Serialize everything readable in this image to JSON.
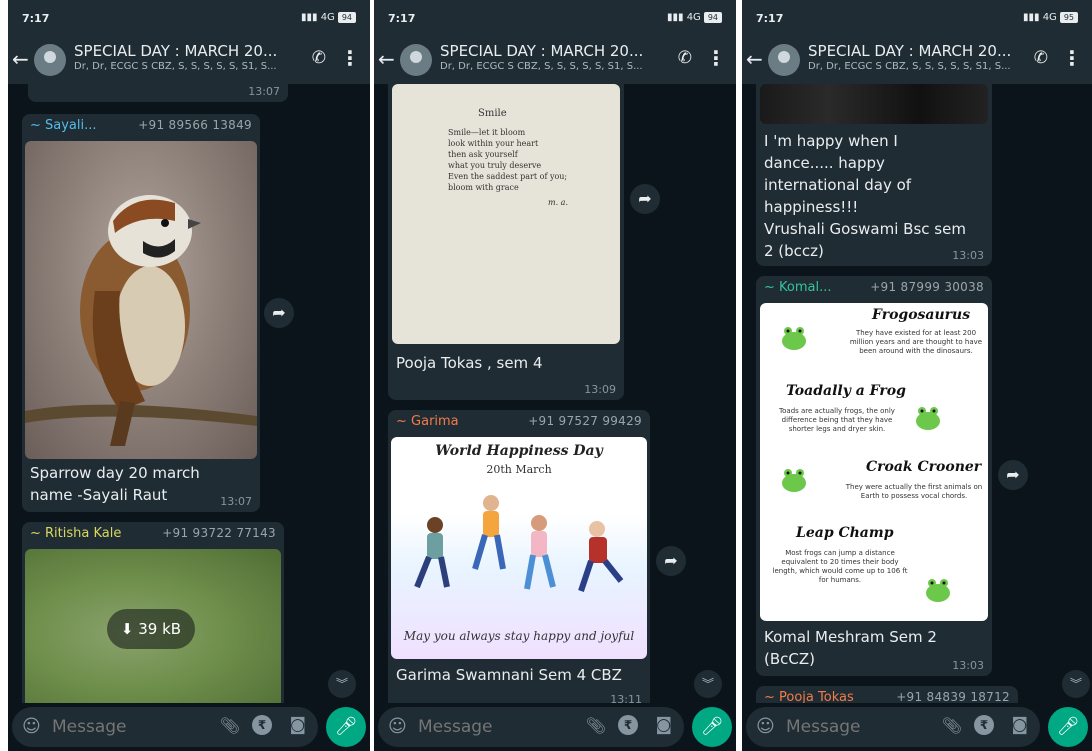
{
  "status": {
    "time": "7:17",
    "network": "4G",
    "battery_left": "94",
    "battery_right": "95"
  },
  "header": {
    "title": "SPECIAL DAY : MARCH 20...",
    "subtitle": "Dr, Dr, ECGC S CBZ, S, S, S, S, S, S1, S..."
  },
  "input": {
    "placeholder": "Message"
  },
  "screens": [
    {
      "top_time": "13:07",
      "messages": [
        {
          "sender": "~ Sayali...",
          "phone": "+91 89566 13849",
          "text_lines": [
            "Sparrow day 20 march",
            "name -Sayali Raut"
          ],
          "time": "13:07"
        },
        {
          "sender": "~ Ritisha Kale",
          "phone": "+91 93722 77143",
          "download": "39 kB"
        }
      ]
    },
    {
      "messages": [
        {
          "poem": {
            "title": "Smile",
            "lines": [
              "Smile—let it bloom",
              "look within your heart",
              "then ask yourself",
              "what you truly deserve",
              "Even the saddest part of you;",
              "bloom with grace"
            ],
            "sign": "m. a."
          },
          "text": "Pooja Tokas , sem 4",
          "time": "13:09"
        },
        {
          "sender": "~ Garima",
          "phone": "+91 97527 99429",
          "image_title": "World Happiness Day",
          "image_date": "20th March",
          "image_footer": "May you always stay happy and joyful",
          "text": "Garima Swamnani Sem 4 CBZ",
          "time": "13:11"
        }
      ]
    },
    {
      "messages": [
        {
          "text_lines": [
            "I 'm happy when I",
            "dance..... happy",
            "international day of",
            "happiness!!!",
            "Vrushali Goswami Bsc sem",
            "2 (bccz)"
          ],
          "time": "13:03"
        },
        {
          "sender": "~ Komal...",
          "phone": "+91 87999 30038",
          "frog": {
            "h1": "Frogosaurus",
            "p1": "They have existed for at least 200 million years and are thought to have been around with the dinosaurs.",
            "h2": "Toadally a Frog",
            "p2": "Toads are actually frogs, the only difference being that they have shorter legs and dryer skin.",
            "h3": "Croak Crooner",
            "p3": "They were actually the first animals on Earth to possess vocal chords.",
            "h4": "Leap Champ",
            "p4": "Most frogs can jump a distance equivalent to 20 times their body length, which would come up to 106 ft for humans."
          },
          "text_lines": [
            "Komal Meshram Sem 2",
            "(BcCZ)"
          ],
          "time": "13:03"
        },
        {
          "sender": "~ Pooja Tokas",
          "phone": "+91 84839 18712"
        }
      ]
    }
  ],
  "colors": {
    "sender_sayali": "#53bdeb",
    "sender_ritisha": "#d9d85f",
    "sender_garima": "#f07b4b",
    "sender_komal": "#33c49d",
    "sender_pooja": "#f07b4b"
  }
}
